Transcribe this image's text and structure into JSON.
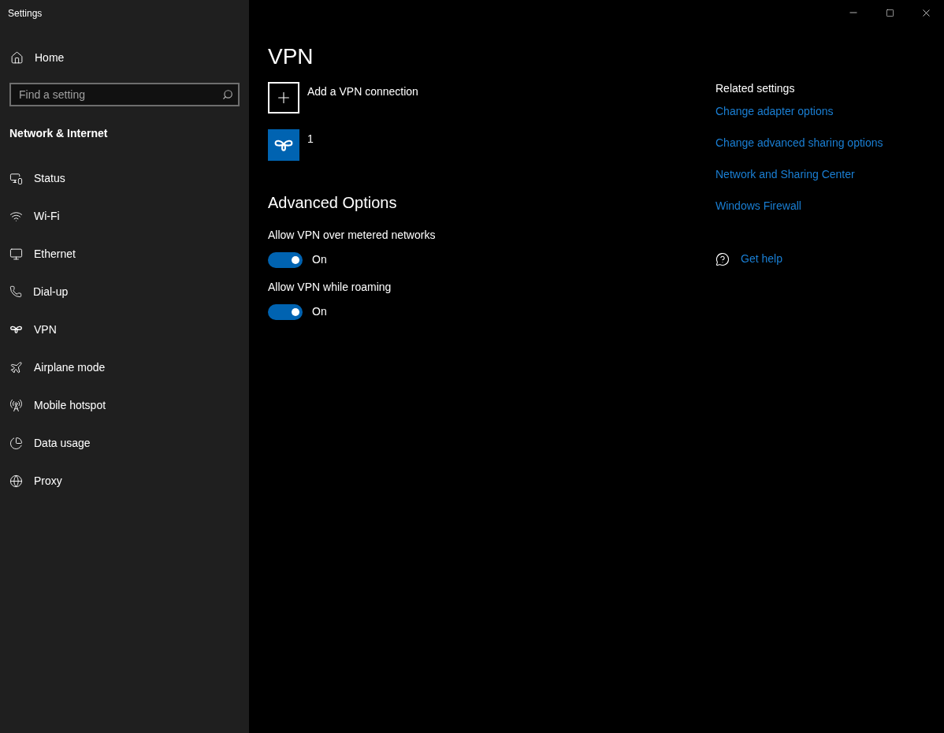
{
  "window": {
    "title": "Settings"
  },
  "sidebar": {
    "home": "Home",
    "search": {
      "placeholder": "Find a setting"
    },
    "category": "Network & Internet",
    "items": [
      {
        "label": "Status"
      },
      {
        "label": "Wi-Fi"
      },
      {
        "label": "Ethernet"
      },
      {
        "label": "Dial-up"
      },
      {
        "label": "VPN"
      },
      {
        "label": "Airplane mode"
      },
      {
        "label": "Mobile hotspot"
      },
      {
        "label": "Data usage"
      },
      {
        "label": "Proxy"
      }
    ]
  },
  "page": {
    "title": "VPN",
    "connections": [
      {
        "kind": "add",
        "label": "Add a VPN connection"
      },
      {
        "kind": "vpn",
        "label": "1"
      }
    ],
    "advanced": {
      "heading": "Advanced Options",
      "toggles": [
        {
          "label": "Allow VPN over metered networks",
          "on": true,
          "state_text": "On"
        },
        {
          "label": "Allow VPN while roaming",
          "on": true,
          "state_text": "On"
        }
      ]
    }
  },
  "related": {
    "heading": "Related settings",
    "links": [
      "Change adapter options",
      "Change advanced sharing options",
      "Network and Sharing Center",
      "Windows Firewall"
    ],
    "help": "Get help"
  }
}
